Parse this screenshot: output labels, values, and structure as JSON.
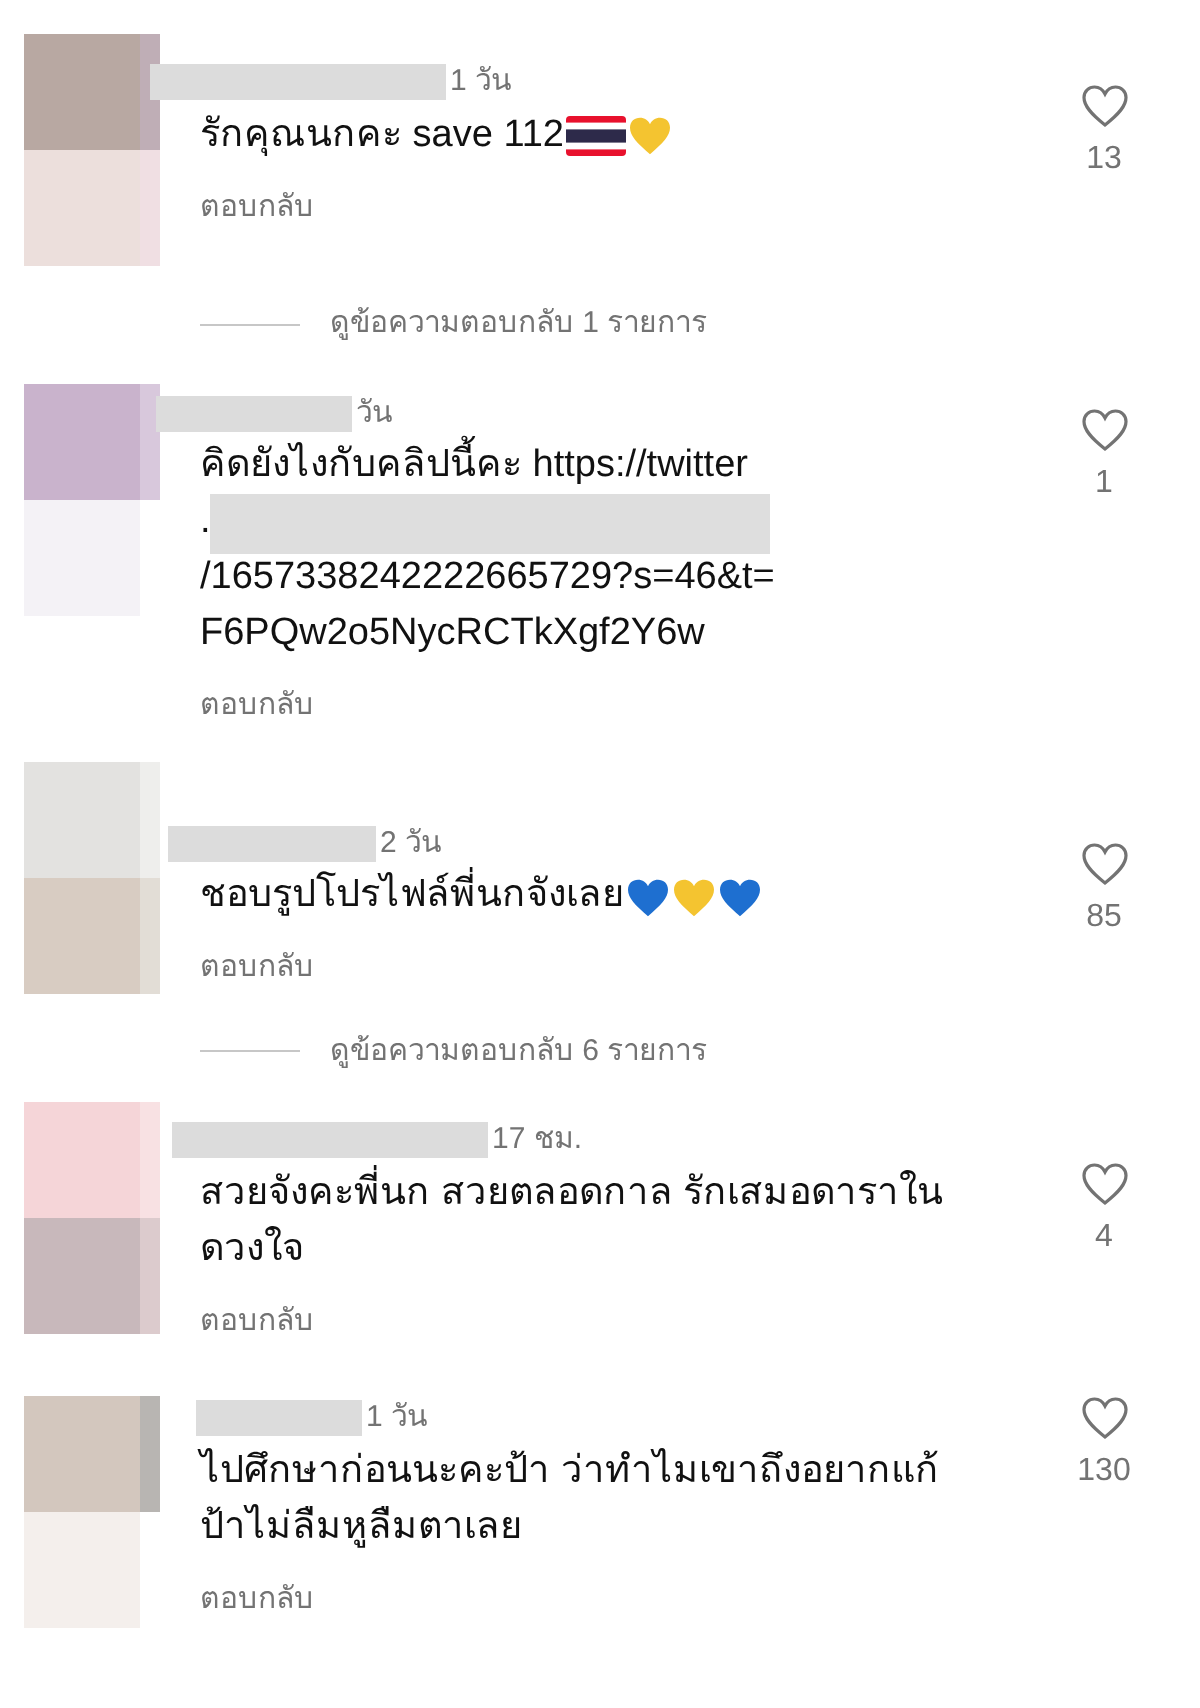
{
  "comments": [
    {
      "time": "1 วัน",
      "lines": [
        {
          "text": "รักคุณนกคะ save 112",
          "redacted": false,
          "emojis": [
            {
              "kind": "flag"
            },
            {
              "kind": "heart",
              "color": "#f4c430"
            }
          ]
        }
      ],
      "reply": "ตอบกลับ",
      "likes": "13",
      "view_replies": "ดูข้อความตอบกลับ 1 รายการ"
    },
    {
      "time": "วัน",
      "lines": [
        {
          "text": "คิดยังไงกับคลิปนี้คะ https://twitter",
          "redacted": false
        },
        {
          "text": ".",
          "redacted": true
        },
        {
          "text": "/1657338242222665729?s=46&t=",
          "redacted": false
        },
        {
          "text": "F6PQw2o5NycRCTkXgf2Y6w",
          "redacted": false
        }
      ],
      "reply": "ตอบกลับ",
      "likes": "1"
    },
    {
      "time": "2 วัน",
      "lines": [
        {
          "text": "ชอบรูปโปรไฟล์พี่นกจังเลย",
          "redacted": false,
          "emojis": [
            {
              "kind": "heart",
              "color": "#1e6fd0"
            },
            {
              "kind": "heart",
              "color": "#f4c430"
            },
            {
              "kind": "heart",
              "color": "#1e6fd0"
            }
          ]
        }
      ],
      "reply": "ตอบกลับ",
      "likes": "85",
      "view_replies": "ดูข้อความตอบกลับ 6 รายการ"
    },
    {
      "time": "17 ชม.",
      "lines": [
        {
          "text": "สวยจังคะพี่นก สวยตลอดกาล รักเสมอดาราใน",
          "redacted": false
        },
        {
          "text": "ดวงใจ",
          "redacted": false
        }
      ],
      "reply": "ตอบกลับ",
      "likes": "4"
    },
    {
      "time": "1 วัน",
      "lines": [
        {
          "text": "ไปศึกษาก่อนนะคะป้า ว่าทำไมเขาถึงอยากแก้",
          "redacted": false
        },
        {
          "text": "ป้าไม่ลืมหูลืมตาเลย",
          "redacted": false
        }
      ],
      "reply": "ตอบกลับ",
      "likes": "130"
    }
  ]
}
